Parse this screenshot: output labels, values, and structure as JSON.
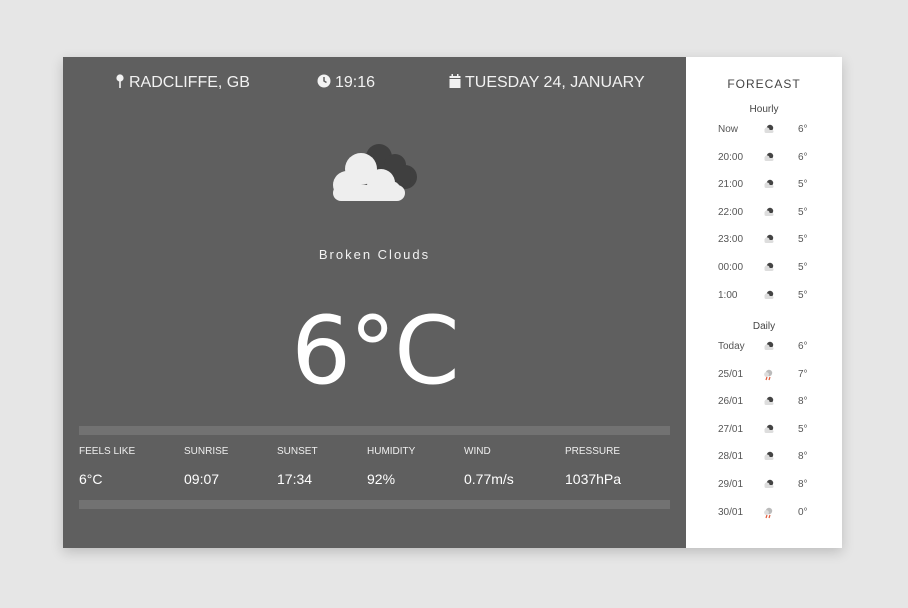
{
  "header": {
    "location": "RADCLIFFE, GB",
    "time": "19:16",
    "date": "TUESDAY 24, JANUARY"
  },
  "current": {
    "icon": "broken-clouds-icon",
    "condition": "Broken Clouds",
    "temperature": "6°C"
  },
  "stats": [
    {
      "label": "FEELS LIKE",
      "value": "6°C"
    },
    {
      "label": "SUNRISE",
      "value": "09:07"
    },
    {
      "label": "SUNSET",
      "value": "17:34"
    },
    {
      "label": "HUMIDITY",
      "value": "92%"
    },
    {
      "label": "WIND",
      "value": "0.77m/s"
    },
    {
      "label": "PRESSURE",
      "value": "1037hPa"
    }
  ],
  "forecast": {
    "title": "FORECAST",
    "hourly_label": "Hourly",
    "hourly": [
      {
        "time": "Now",
        "icon": "cloud-icon",
        "temp": "6°"
      },
      {
        "time": "20:00",
        "icon": "cloud-icon",
        "temp": "6°"
      },
      {
        "time": "21:00",
        "icon": "cloud-icon",
        "temp": "5°"
      },
      {
        "time": "22:00",
        "icon": "cloud-icon",
        "temp": "5°"
      },
      {
        "time": "23:00",
        "icon": "cloud-icon",
        "temp": "5°"
      },
      {
        "time": "00:00",
        "icon": "cloud-icon",
        "temp": "5°"
      },
      {
        "time": "1:00",
        "icon": "cloud-icon",
        "temp": "5°"
      }
    ],
    "daily_label": "Daily",
    "daily": [
      {
        "time": "Today",
        "icon": "cloud-icon",
        "temp": "6°"
      },
      {
        "time": "25/01",
        "icon": "rain-icon",
        "temp": "7°"
      },
      {
        "time": "26/01",
        "icon": "cloud-icon",
        "temp": "8°"
      },
      {
        "time": "27/01",
        "icon": "cloud-icon",
        "temp": "5°"
      },
      {
        "time": "28/01",
        "icon": "cloud-icon",
        "temp": "8°"
      },
      {
        "time": "29/01",
        "icon": "cloud-icon",
        "temp": "8°"
      },
      {
        "time": "30/01",
        "icon": "rain-icon",
        "temp": "0°"
      }
    ]
  },
  "colors": {
    "page_bg": "#e6e6e6",
    "panel_bg": "#5f5f5f",
    "sidebar_bg": "#ffffff",
    "rain_accent": "#e05a3a"
  }
}
